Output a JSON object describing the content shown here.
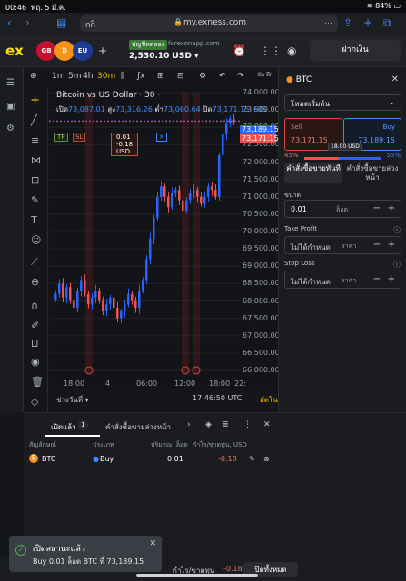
{
  "status": {
    "time": "00:46",
    "date": "พฤ. 5 มี.ค.",
    "battery": "84%"
  },
  "browser": {
    "tab_text": "กกิ",
    "url": "my.exness.com",
    "more": "…"
  },
  "header": {
    "logo": "ex",
    "account_label": "บัญชีทดลอง",
    "server": "forexonapp.com",
    "balance": "2,530.10 USD",
    "deposit": "ฝากเงิน",
    "tabs": [
      "BTC",
      "EUR",
      "GBP"
    ]
  },
  "toolbar": {
    "timeframes": [
      "1m",
      "5m",
      "4h",
      "30m"
    ],
    "active": "30m",
    "extra": "บัน ทึก"
  },
  "chart": {
    "title": "Bitcoin vs US Dollar · 30 ·",
    "open_label": "เปิด",
    "open": "73,087.01",
    "high_label": "สูง",
    "high": "73,316.26",
    "low_label": "ต่ำ",
    "low": "73,060.64",
    "close_label": "ปิด",
    "close": "73,171.15",
    "change": "+85",
    "tp": "TP",
    "sl": "SL",
    "position_pl": "0.01  -0.18 USD",
    "x": "✕",
    "range_label": "ช่วงวันที่",
    "clock": "17:46:50 UTC",
    "auto": "อัตโนมัติ",
    "buy_price_tag": "73,189.15",
    "sell_price_tag": "73,171.15"
  },
  "chart_data": {
    "type": "candlestick",
    "symbol": "BTCUSD",
    "timeframe": "30m",
    "y_ticks": [
      "74,000.00",
      "73,500.00",
      "73,000.00",
      "72,500.00",
      "72,000.00",
      "71,500.00",
      "71,000.00",
      "70,500.00",
      "70,000.00",
      "69,500.00",
      "69,000.00",
      "68,500.00",
      "68,000.00",
      "67,500.00",
      "67,000.00",
      "66,500.00",
      "66,000.00"
    ],
    "x_ticks": [
      "18:00",
      "4",
      "06:00",
      "12:00",
      "18:00",
      "22:"
    ],
    "ylim": [
      66000,
      74000
    ],
    "close_series": [
      68200,
      68500,
      68100,
      68400,
      68000,
      67800,
      68300,
      68600,
      68200,
      67900,
      68100,
      68300,
      68000,
      67700,
      67900,
      68100,
      67800,
      67500,
      67700,
      67900,
      68200,
      68000,
      67800,
      68300,
      68600,
      69200,
      69800,
      70400,
      71000,
      71300,
      71000,
      70700,
      71100,
      71200,
      70900,
      70600,
      70900,
      71100,
      71200,
      71000,
      70800,
      71000,
      71300,
      71200,
      71000,
      72200,
      72800,
      73100,
      73250,
      73171
    ]
  },
  "right_panel": {
    "symbol": "BTC",
    "order_type": "โหมดเริ่มต้น",
    "sell_label": "Sell",
    "sell_price": "73,171.15",
    "buy_label": "Buy",
    "buy_price": "73,189.15",
    "spread": "18.00 USD",
    "sell_pct": "45%",
    "buy_pct": "55%",
    "tab_market": "คำสั่งซื้อขายทันที",
    "tab_pending": "คำสั่งซื้อขายล่วงหน้า",
    "volume_label": "ขนาด",
    "volume": "0.01",
    "volume_unit": "ล็อต",
    "tp_label": "Take Profit",
    "tp_value": "ไม่ได้กำหนด",
    "tp_unit": "ราคา",
    "sl_label": "Stop Loss",
    "sl_value": "ไม่ได้กำหนด",
    "sl_unit": "ราคา",
    "minus": "−",
    "plus": "+"
  },
  "bottom": {
    "tab_open": "เปิดแล้ว",
    "open_count": "1",
    "tab_pending": "คำสั่งซื้อขายล่วงหน้า",
    "headers": {
      "symbol": "สัญลักษณ์",
      "type": "ประเภท",
      "volume": "ปริมาณ, ล็อต",
      "pl": "กำไร/ขาดทุน, USD"
    },
    "rows": [
      {
        "symbol": "BTC",
        "type": "Buy",
        "volume": "0.01",
        "pl": "-0.18"
      }
    ],
    "total_label": "กำไร/ขาดทุน",
    "total_pl": "-0.18",
    "close_all": "ปิดทั้งหมด"
  },
  "toast": {
    "title": "เปิดสถานะแล้ว",
    "body": "Buy 0.01 ล็อต BTC ที่ 73,189.15"
  },
  "colors": {
    "bull": "#2962ff",
    "bear": "#ef5350",
    "accent": "#ffde02"
  }
}
